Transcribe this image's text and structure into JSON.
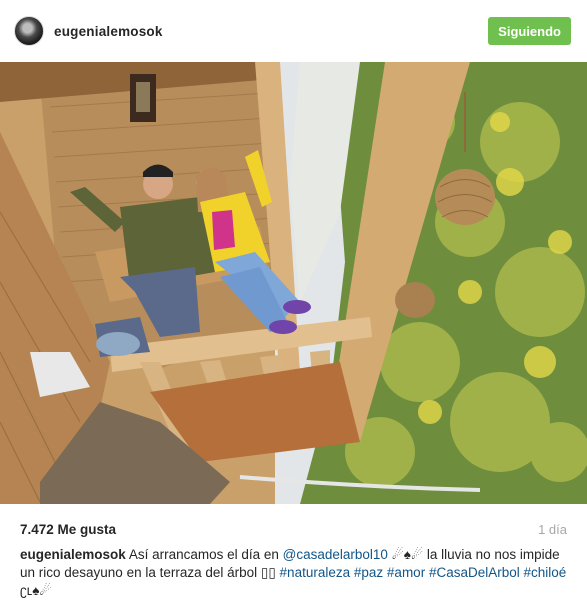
{
  "header": {
    "username": "eugenialemosok",
    "follow_label": "Siguiendo"
  },
  "colors": {
    "follow_button": "#70c050",
    "link": "#125688",
    "time": "#a5a7aa"
  },
  "post": {
    "likes": "7.472 Me gusta",
    "time": "1 día",
    "caption": {
      "user": "eugenialemosok",
      "text_1": "Así arrancamos el día en",
      "mention": "@casadelarbol10",
      "emoji_1": "☄♠☄",
      "text_2": "la lluvia no nos impide un rico desayuno en la terraza del árbol",
      "emoji_2": "▯▯",
      "tag_1": "#naturaleza",
      "tag_2": "#paz",
      "tag_3": "#amor",
      "tag_4": "#CasaDelArbol",
      "tag_5": "#chiloé",
      "emoji_3": "ʗʟ♠☄"
    }
  }
}
